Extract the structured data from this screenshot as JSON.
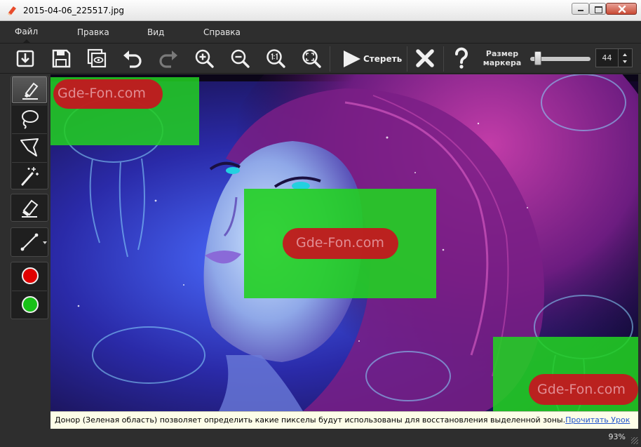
{
  "window": {
    "title": "2015-04-06_225517.jpg"
  },
  "menu": {
    "file": "Файл",
    "edit": "Правка",
    "view": "Вид",
    "help": "Справка"
  },
  "toolbar": {
    "erase_label": "Стереть",
    "marker_label_line1": "Размер",
    "marker_label_line2": "маркера",
    "marker_size": "44",
    "marker_slider_fraction": 0.05
  },
  "tools": {
    "colors": {
      "red": "#e00000",
      "green": "#18c018"
    }
  },
  "canvas": {
    "watermark": "Gde-Fon.com",
    "donor_color": "#22d022",
    "mark_color": "#c8141e"
  },
  "hint": {
    "text": "Донор (Зеленая область) позволяет определить какие пикселы будут использованы для восстановления выделенной зоны.",
    "link": "Прочитать Урок"
  },
  "status": {
    "zoom": "93%"
  }
}
